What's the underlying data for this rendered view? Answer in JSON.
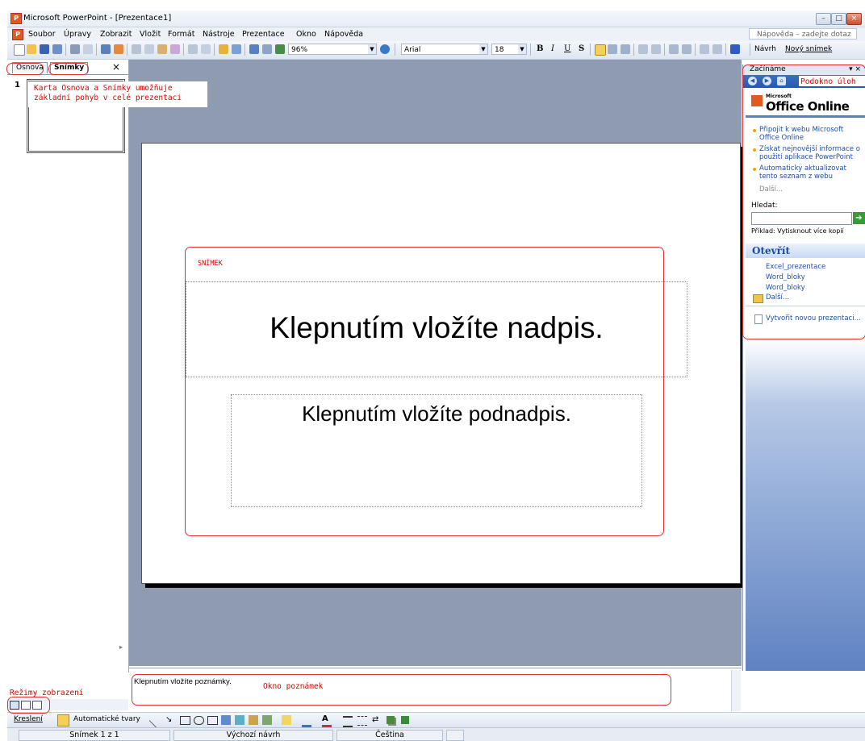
{
  "window": {
    "title": "Microsoft PowerPoint - [Prezentace1]"
  },
  "menu": {
    "items": [
      "Soubor",
      "Úpravy",
      "Zobrazit",
      "Vložit",
      "Formát",
      "Nástroje",
      "Prezentace",
      "Okno",
      "Nápověda"
    ],
    "help_placeholder": "Nápověda – zadejte dotaz"
  },
  "toolbar": {
    "zoom": "96%",
    "font": "Arial",
    "font_size": "18",
    "bold": "B",
    "italic": "I",
    "underline": "U",
    "shadow": "S",
    "design_label": "Návrh",
    "new_slide_label": "Nový snímek"
  },
  "outline_pane": {
    "tab_outline": "Osnova",
    "tab_slides": "Snímky",
    "close": "×",
    "slide_number": "1"
  },
  "slide": {
    "title_placeholder": "Klepnutím vložíte nadpis.",
    "subtitle_placeholder": "Klepnutím vložíte podnadpis."
  },
  "task_pane": {
    "header": "Začínáme",
    "office_online_small": "Microsoft",
    "office_online": "Office Online",
    "links": [
      "Připojit k webu Microsoft Office Online",
      "Získat nejnovější informace o použití aplikace PowerPoint",
      "Automaticky aktualizovat tento seznam z webu"
    ],
    "more": "Další...",
    "search_label": "Hledat:",
    "search_value": "",
    "example": "Příklad: Vytisknout více kopií",
    "open_heading": "Otevřít",
    "files": [
      "Excel_prezentace",
      "Word_bloky",
      "Word_bloky"
    ],
    "open_more": "Další...",
    "new_presentation": "Vytvořit novou prezentaci..."
  },
  "notes": {
    "placeholder": "Klepnutím vložíte poznámky."
  },
  "drawing_toolbar": {
    "drawing": "Kreslení",
    "autoshapes": "Automatické tvary"
  },
  "status_bar": {
    "slide": "Snímek 1 z 1",
    "design": "Výchozí návrh",
    "language": "Čeština"
  },
  "annotations": {
    "outline_tab_note": "Karta Osnova a Snímky umožňuje základní pohyb v celé prezentaci",
    "slide_label": "SNÍMEK",
    "task_pane_label": "Podokno úloh",
    "notes_label": "Okno poznámek",
    "view_modes_label": "Režimy zobrazení"
  }
}
